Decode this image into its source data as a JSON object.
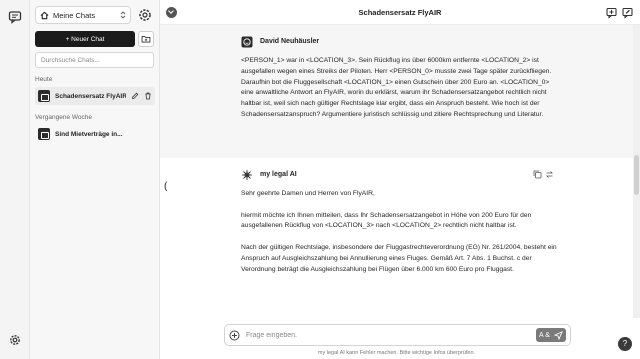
{
  "sidebar": {
    "workspace": "Meine Chats",
    "new_chat": "+ Neuer Chat",
    "search_placeholder": "Durchsuche Chats...",
    "groups": [
      {
        "label": "Heute",
        "items": [
          {
            "title": "Schadensersatz FlyAIR",
            "active": true
          }
        ]
      },
      {
        "label": "Vergangene Woche",
        "items": [
          {
            "title": "Sind Mietverträge in..."
          }
        ]
      }
    ]
  },
  "header": {
    "title": "Schadensersatz FlyAIR"
  },
  "messages": {
    "user": {
      "author": "David Neuhäusler",
      "text": "<PERSON_1> war in <LOCATION_3>. Sein Rückflug ins über 6000km entfernte <LOCATION_2> ist ausgefallen wegen eines Streiks der Piloten. Herr <PERSON_0> musste zwei Tage später zurückfliegen. Daraufhin bot die Fluggesellschaft <LOCATION_1> einen Gutschein über 200 Euro an. <LOCATION_0> eine anwaltliche Antwort an FlyAIR, worin du erklärst, warum ihr Schadensersatzangebot rechtlich nicht haltbar ist, weil sich nach gültiger Rechtslage klar ergibt, dass ein Anspruch besteht. Wie hoch ist der Schadensersatzanspruch? Argumentiere juristisch schlüssig und zitiere Rechtsprechung und Literatur."
    },
    "ai": {
      "author": "my legal AI",
      "paragraphs": [
        "Sehr geehrte Damen und Herren von FlyAIR,",
        "hiermit möchte ich Ihnen mitteilen, dass Ihr Schadensersatzangebot in Höhe von 200 Euro für den ausgefallenen Rückflug von <LOCATION_3> nach <LOCATION_2> rechtlich nicht haltbar ist.",
        "Nach der gültigen Rechtslage, insbesondere der Fluggastrechteverordnung (EG) Nr. 261/2004, besteht ein Anspruch auf Ausgleichszahlung bei Annullierung eines Fluges. Gemäß Art. 7 Abs. 1 Buchst. c der Verordnung beträgt die Ausgleichszahlung bei Flügen über 6.000 km 600 Euro pro Fluggast."
      ]
    },
    "stray_char": "("
  },
  "composer": {
    "placeholder": "Frage eingeben.",
    "send_label": "A &"
  },
  "footer": {
    "disclaimer": "my legal AI kann Fehler machen. Bitte wichtige Infos überprüfen."
  },
  "help": {
    "label": "?"
  },
  "icons": {
    "rail_top": "chat-bubble-icon",
    "rail_bottom": "gear-icon",
    "workspace": "home-icon",
    "header_left": "chevron-down-circle-icon",
    "header_right": [
      "new-chat-icon",
      "edit-chat-icon"
    ]
  }
}
